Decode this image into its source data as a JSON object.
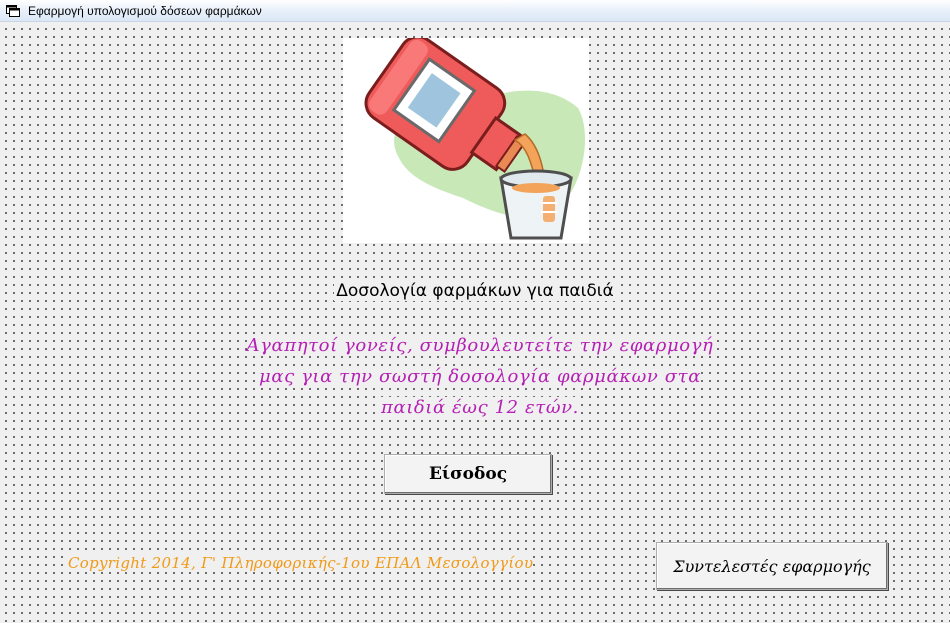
{
  "window": {
    "title": "Εφαρμογή υπολογισμού δόσεων φαρμάκων"
  },
  "heading": "Δοσολογία φαρμάκων για παιδιά",
  "message_lines": [
    "Αγαπητοί γονείς, συμβουλευτείτε την εφαρμογή",
    "μας για την σωστή δοσολογία φαρμάκων στα",
    "παιδιά έως 12 ετών."
  ],
  "buttons": {
    "enter_label": "Είσοδος",
    "credits_label": "Συντελεστές εφαρμογής"
  },
  "copyright": "Copyright 2014, Γ' Πληροφορικής-1ου ΕΠΑΛ Μεσολογγίου",
  "image": {
    "icon": "medicine-bottle-pouring-into-cup"
  },
  "colors": {
    "message": "#b41fb4",
    "copyright": "#f09a17"
  }
}
